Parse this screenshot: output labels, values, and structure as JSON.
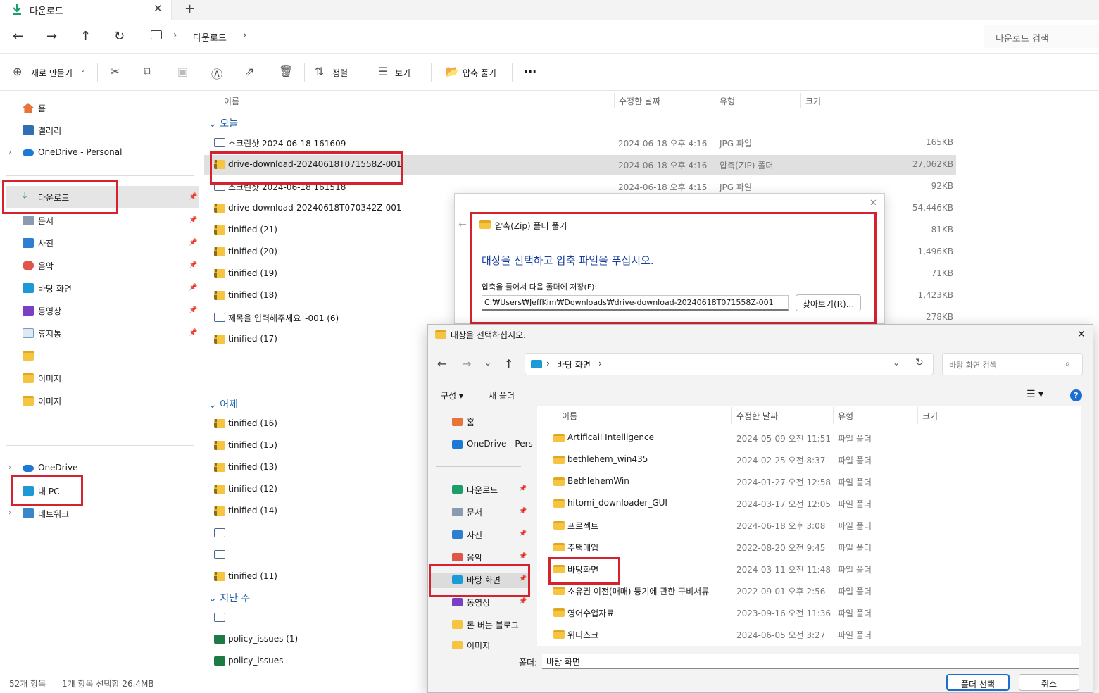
{
  "tab": {
    "title": "다운로드",
    "close": "✕",
    "add": "+"
  },
  "nav": {
    "back": "←",
    "forward": "→",
    "up": "↑",
    "refresh": "↻",
    "sep": "›",
    "location": "다운로드",
    "search_placeholder": "다운로드 검색"
  },
  "toolbar": {
    "new": "새로 만들기",
    "sort": "정렬",
    "view": "보기",
    "extract": "압축 풀기",
    "more": "···"
  },
  "sidebar": {
    "home": "홈",
    "gallery": "갤러리",
    "onedrive_personal": "OneDrive - Personal",
    "quick": [
      {
        "label": "다운로드"
      },
      {
        "label": "문서"
      },
      {
        "label": "사진"
      },
      {
        "label": "음악"
      },
      {
        "label": "바탕 화면"
      },
      {
        "label": "동영상"
      },
      {
        "label": "휴지통"
      }
    ],
    "img1": "이미지",
    "img2": "이미지",
    "onedrive": "OneDrive",
    "mypc": "내 PC",
    "network": "네트워크"
  },
  "columns": {
    "name": "이름",
    "date": "수정한 날짜",
    "type": "유형",
    "size": "크기"
  },
  "groups": {
    "today": "오늘",
    "yesterday": "어제",
    "lastweek": "지난 주"
  },
  "files": [
    {
      "name": "스크린샷 2024-06-18 161609",
      "date": "2024-06-18 오후 4:16",
      "type": "JPG 파일",
      "size": "165KB",
      "icon": "doc"
    },
    {
      "name": "drive-download-20240618T071558Z-001",
      "date": "2024-06-18 오후 4:16",
      "type": "압축(ZIP) 폴더",
      "size": "27,062KB",
      "icon": "zip"
    },
    {
      "name": "스크린샷 2024-06-18 161518",
      "date": "2024-06-18 오후 4:15",
      "type": "JPG 파일",
      "size": "92KB",
      "icon": "doc"
    },
    {
      "name": "drive-download-20240618T070342Z-001",
      "date": "",
      "type": "",
      "size": "54,446KB",
      "icon": "zip"
    },
    {
      "name": "tinified (21)",
      "date": "",
      "type": "",
      "size": "81KB",
      "icon": "zip"
    },
    {
      "name": "tinified (20)",
      "date": "",
      "type": "",
      "size": "1,496KB",
      "icon": "zip"
    },
    {
      "name": "tinified (19)",
      "date": "",
      "type": "",
      "size": "71KB",
      "icon": "zip"
    },
    {
      "name": "tinified (18)",
      "date": "",
      "type": "",
      "size": "1,423KB",
      "icon": "zip"
    },
    {
      "name": "제목을 입력해주세요_-001 (6)",
      "date": "",
      "type": "",
      "size": "278KB",
      "icon": "doc"
    },
    {
      "name": "tinified (17)",
      "date": "",
      "type": "",
      "size": "",
      "icon": "zip"
    }
  ],
  "files_yesterday": [
    {
      "name": "tinified (16)",
      "icon": "zip"
    },
    {
      "name": "tinified (15)",
      "icon": "zip"
    },
    {
      "name": "tinified (13)",
      "icon": "zip"
    },
    {
      "name": "tinified (12)",
      "icon": "zip"
    },
    {
      "name": "tinified (14)",
      "icon": "zip"
    },
    {
      "name": "",
      "icon": "doc"
    },
    {
      "name": "",
      "icon": "doc"
    },
    {
      "name": "tinified (11)",
      "icon": "zip"
    }
  ],
  "files_lastweek": [
    {
      "name": "",
      "icon": "doc"
    },
    {
      "name": "policy_issues (1)",
      "icon": "xls"
    },
    {
      "name": "policy_issues",
      "icon": "xls"
    }
  ],
  "status": {
    "count": "52개 항목",
    "selected": "1개 항목 선택함 26.4MB"
  },
  "extract_dialog": {
    "title": "압축(Zip) 폴더 풀기",
    "heading": "대상을 선택하고 압축 파일을 푸십시오.",
    "label": "압축을 풀어서 다음 폴더에 저장(F):",
    "path": "C:₩Users₩JeffKim₩Downloads₩drive-download-20240618T071558Z-001",
    "browse": "찾아보기(R)...",
    "close": "✕",
    "back": "←"
  },
  "picker": {
    "title": "대상을 선택하십시오.",
    "close": "✕",
    "location": "바탕 화면",
    "search_placeholder": "바탕 화면 검색",
    "organize": "구성 ▾",
    "new_folder": "새 폴더",
    "help": "?",
    "side": {
      "home": "홈",
      "onedrive": "OneDrive - Pers",
      "downloads": "다운로드",
      "docs": "문서",
      "pics": "사진",
      "music": "음악",
      "desktop": "바탕 화면",
      "videos": "동영상",
      "money": "돈 버는 블로그",
      "img": "이미지"
    },
    "columns": {
      "name": "이름",
      "date": "수정한 날짜",
      "type": "유형",
      "size": "크기"
    },
    "folders": [
      {
        "name": "Artificail Intelligence",
        "date": "2024-05-09 오전 11:51",
        "type": "파일 폴더"
      },
      {
        "name": "bethlehem_win435",
        "date": "2024-02-25 오전 8:37",
        "type": "파일 폴더"
      },
      {
        "name": "BethlehemWin",
        "date": "2024-01-27 오전 12:58",
        "type": "파일 폴더"
      },
      {
        "name": "hitomi_downloader_GUI",
        "date": "2024-03-17 오전 12:05",
        "type": "파일 폴더"
      },
      {
        "name": "프로젝트",
        "date": "2024-06-18 오후 3:08",
        "type": "파일 폴더"
      },
      {
        "name": "주택매입",
        "date": "2022-08-20 오전 9:45",
        "type": "파일 폴더"
      },
      {
        "name": "바탕화면",
        "date": "2024-03-11 오전 11:48",
        "type": "파일 폴더"
      },
      {
        "name": "소유권 이전(매매) 등기에 관한 구비서류",
        "date": "2022-09-01 오후 2:56",
        "type": "파일 폴더"
      },
      {
        "name": "영어수업자료",
        "date": "2023-09-16 오전 11:36",
        "type": "파일 폴더"
      },
      {
        "name": "위디스크",
        "date": "2024-06-05 오전 3:27",
        "type": "파일 폴더"
      }
    ],
    "folder_label": "폴더:",
    "folder_value": "바탕 화면",
    "select": "폴더 선택",
    "cancel": "취소"
  }
}
